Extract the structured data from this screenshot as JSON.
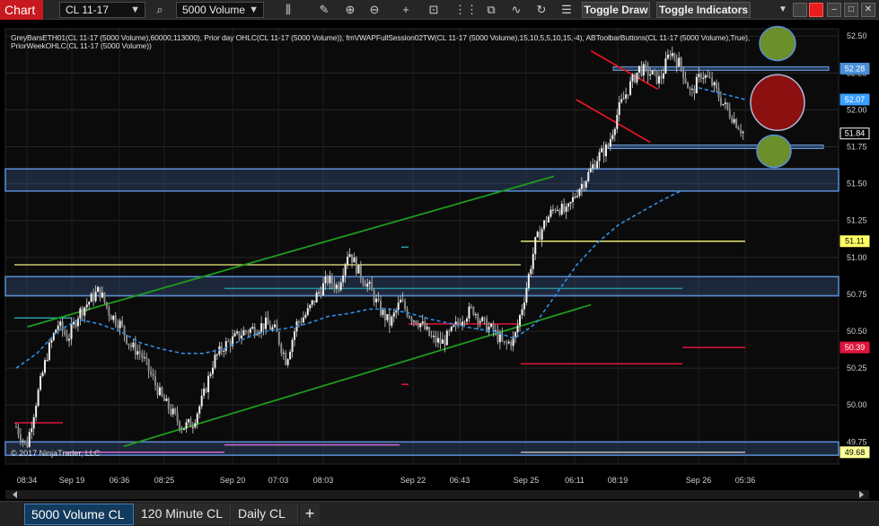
{
  "toolbar": {
    "chart_tab": "Chart",
    "instrument": "CL 11-17",
    "bars_type": "5000 Volume",
    "toggle_draw": "Toggle Draw",
    "toggle_indicators": "Toggle Indicators",
    "icons": [
      "magnifier-icon",
      "bar-style-icon",
      "zoom-in-icon",
      "zoom-out-icon",
      "crosshair-icon",
      "data-box-icon",
      "indicators-icon",
      "strategies-icon",
      "drawing-tools-icon",
      "refresh-icon",
      "properties-icon"
    ]
  },
  "indicators_text": {
    "line1": "GreyBarsETH01(CL 11-17 (5000 Volume),60000,113000), Prior day OHLC(CL 11-17 (5000 Volume)), fmVWAPFullSession02TW(CL 11-17 (5000 Volume),15,10,5,5,10,15,-4), ABToolbarButtons(CL 11-17 (5000 Volume),True),",
    "line2": "PriorWeekOHLC(CL 11-17 (5000 Volume))"
  },
  "copyright": "© 2017 NinjaTrader, LLC",
  "chart_data": {
    "type": "candlestick",
    "instrument": "CL 11-17",
    "interval": "5000 Volume",
    "y_axis": {
      "range": [
        49.6,
        52.55
      ],
      "ticks": [
        "52.50",
        "52.25",
        "52.00",
        "51.75",
        "51.50",
        "51.25",
        "51.00",
        "50.75",
        "50.50",
        "50.25",
        "50.00",
        "49.75"
      ]
    },
    "price_markers": [
      {
        "label": "52.28",
        "value": 52.28,
        "color": "#4a8fd8"
      },
      {
        "label": "52.07",
        "value": 52.07,
        "color": "#3aa0ff"
      },
      {
        "label": "51.84",
        "value": 51.84,
        "color": "#000000"
      },
      {
        "label": "51.11",
        "value": 51.11,
        "color": "#ffff66"
      },
      {
        "label": "50.39",
        "value": 50.39,
        "color": "#e0143c"
      },
      {
        "label": "49.68",
        "value": 49.68,
        "color": "#ffff99"
      }
    ],
    "x_labels": [
      "08:34",
      "Sep 19",
      "06:36",
      "08:25",
      "Sep 20",
      "07:03",
      "08:03",
      "Sep 22",
      "06:43",
      "Sep 25",
      "06:11",
      "08:19",
      "Sep 26",
      "05:36"
    ],
    "close_path": [
      49.85,
      49.72,
      50.05,
      50.35,
      50.55,
      50.45,
      50.62,
      50.7,
      50.78,
      50.62,
      50.55,
      50.4,
      50.35,
      50.2,
      50.05,
      49.95,
      49.85,
      49.88,
      50.05,
      50.3,
      50.4,
      50.45,
      50.5,
      50.52,
      50.55,
      50.5,
      50.3,
      50.55,
      50.62,
      50.75,
      50.85,
      50.8,
      51.05,
      50.9,
      50.8,
      50.65,
      50.55,
      50.7,
      50.6,
      50.55,
      50.45,
      50.42,
      50.5,
      50.6,
      50.65,
      50.55,
      50.5,
      50.4,
      50.45,
      50.75,
      51.1,
      51.25,
      51.35,
      51.3,
      51.45,
      51.55,
      51.68,
      51.75,
      52.0,
      52.15,
      52.28,
      52.25,
      52.2,
      52.4,
      52.3,
      52.1,
      52.25,
      52.18,
      52.05,
      51.95,
      51.85
    ],
    "vwap_path": [
      50.25,
      50.35,
      50.5,
      50.58,
      50.55,
      50.5,
      50.42,
      50.38,
      50.35,
      50.35,
      50.38,
      50.45,
      50.5,
      50.52,
      50.55,
      50.6,
      50.62,
      50.65,
      50.65,
      50.62,
      50.58,
      50.55,
      50.52,
      50.5,
      50.45,
      50.55,
      50.75,
      50.95,
      51.1,
      51.22,
      51.3,
      51.38,
      51.45
    ],
    "zones": [
      {
        "from": 51.45,
        "to": 51.6
      },
      {
        "from": 50.74,
        "to": 50.87
      },
      {
        "from": 49.66,
        "to": 49.75
      }
    ],
    "zone_lines": [
      52.28,
      51.75
    ],
    "trend_lines": [
      {
        "color": "green",
        "from": [
          0.02,
          50.53
        ],
        "to": [
          0.73,
          51.55
        ]
      },
      {
        "color": "green",
        "from": [
          0.15,
          49.72
        ],
        "to": [
          0.78,
          50.68
        ]
      },
      {
        "color": "red",
        "from": [
          0.78,
          52.4
        ],
        "to": [
          0.87,
          52.14
        ]
      },
      {
        "color": "red",
        "from": [
          0.76,
          52.07
        ],
        "to": [
          0.86,
          51.78
        ]
      }
    ],
    "circles": [
      {
        "color": "green",
        "value": 52.45
      },
      {
        "color": "red",
        "value": 52.05
      },
      {
        "color": "green",
        "value": 51.72
      }
    ]
  },
  "bottom_tabs": [
    "5000 Volume CL",
    "120 Minute CL",
    "Daily CL"
  ],
  "add_tab": "+"
}
